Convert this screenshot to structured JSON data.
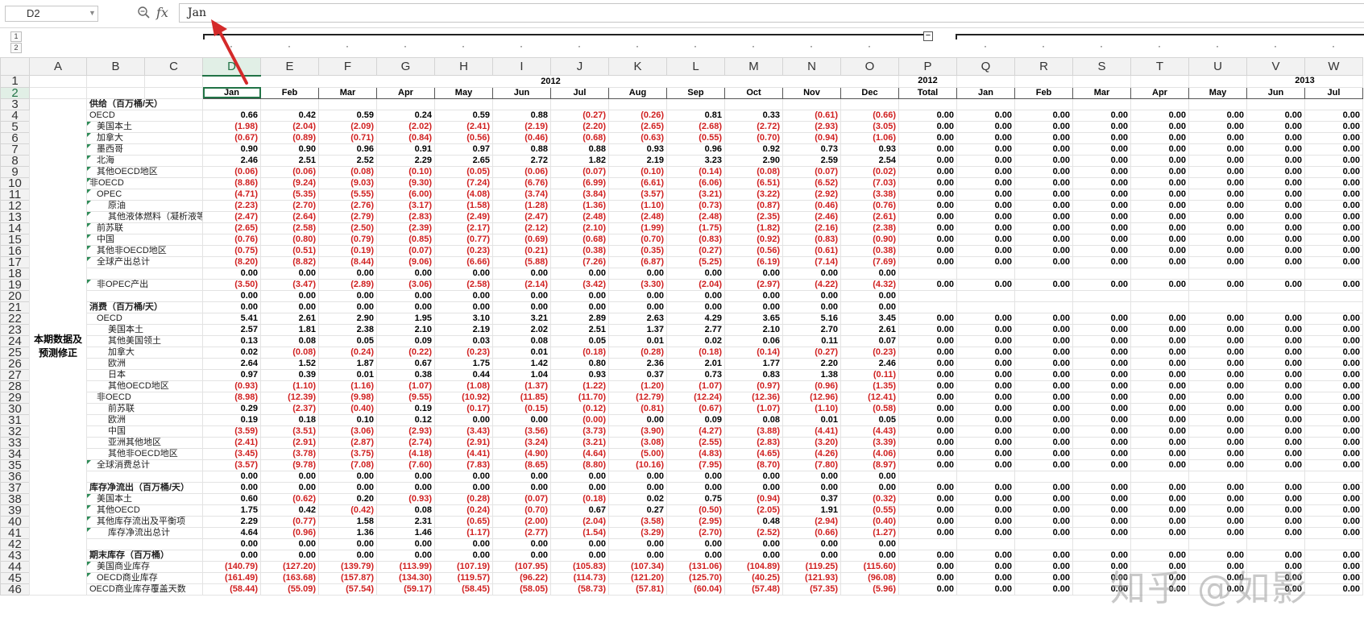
{
  "formula_bar": {
    "name_box": "D2",
    "formula": "Jan"
  },
  "outline": {
    "levels": [
      "1",
      "2"
    ],
    "collapse_symbol": "−"
  },
  "columns": [
    "A",
    "B",
    "C",
    "D",
    "E",
    "F",
    "G",
    "H",
    "I",
    "J",
    "K",
    "L",
    "M",
    "N",
    "O",
    "P",
    "Q",
    "R",
    "S",
    "T",
    "U",
    "V",
    "W"
  ],
  "row1": {
    "y2012": "2012",
    "y2012_total": "2012",
    "y2013": "2013"
  },
  "row2": [
    "Jan",
    "Feb",
    "Mar",
    "Apr",
    "May",
    "Jun",
    "Jul",
    "Aug",
    "Sep",
    "Oct",
    "Nov",
    "Dec",
    "Total",
    "Jan",
    "Feb",
    "Mar",
    "Apr",
    "May",
    "Jun",
    "Jul"
  ],
  "merged_label": "本期数据及预测修正",
  "rows": [
    {
      "r": 3,
      "label": "供给（百万桶/天）",
      "indent": 0,
      "bold": true,
      "vals": [],
      "tail": ""
    },
    {
      "r": 4,
      "label": "OECD",
      "indent": 0,
      "vals": [
        "0.66",
        "0.42",
        "0.59",
        "0.24",
        "0.59",
        "0.88",
        "(0.27)",
        "(0.26)",
        "0.81",
        "0.33",
        "(0.61)",
        "(0.66)"
      ],
      "tail": "z"
    },
    {
      "r": 5,
      "label": "美国本土",
      "indent": 1,
      "tri": true,
      "vals": [
        "(1.98)",
        "(2.04)",
        "(2.09)",
        "(2.02)",
        "(2.41)",
        "(2.19)",
        "(2.20)",
        "(2.65)",
        "(2.68)",
        "(2.72)",
        "(2.93)",
        "(3.05)"
      ],
      "tail": "z"
    },
    {
      "r": 6,
      "label": "加拿大",
      "indent": 1,
      "tri": true,
      "vals": [
        "(0.67)",
        "(0.89)",
        "(0.71)",
        "(0.84)",
        "(0.56)",
        "(0.46)",
        "(0.68)",
        "(0.63)",
        "(0.55)",
        "(0.70)",
        "(0.94)",
        "(1.06)"
      ],
      "tail": "z"
    },
    {
      "r": 7,
      "label": "墨西哥",
      "indent": 1,
      "tri": true,
      "vals": [
        "0.90",
        "0.90",
        "0.96",
        "0.91",
        "0.97",
        "0.88",
        "0.88",
        "0.93",
        "0.96",
        "0.92",
        "0.73",
        "0.93"
      ],
      "tail": "z"
    },
    {
      "r": 8,
      "label": "北海",
      "indent": 1,
      "tri": true,
      "vals": [
        "2.46",
        "2.51",
        "2.52",
        "2.29",
        "2.65",
        "2.72",
        "1.82",
        "2.19",
        "3.23",
        "2.90",
        "2.59",
        "2.54"
      ],
      "tail": "z"
    },
    {
      "r": 9,
      "label": "其他OECD地区",
      "indent": 1,
      "tri": true,
      "vals": [
        "(0.06)",
        "(0.06)",
        "(0.08)",
        "(0.10)",
        "(0.05)",
        "(0.06)",
        "(0.07)",
        "(0.10)",
        "(0.14)",
        "(0.08)",
        "(0.07)",
        "(0.02)"
      ],
      "tail": "z"
    },
    {
      "r": 10,
      "label": "非OECD",
      "indent": 0,
      "tri": true,
      "vals": [
        "(8.86)",
        "(9.24)",
        "(9.03)",
        "(9.30)",
        "(7.24)",
        "(6.76)",
        "(6.99)",
        "(6.61)",
        "(6.06)",
        "(6.51)",
        "(6.52)",
        "(7.03)"
      ],
      "tail": "z"
    },
    {
      "r": 11,
      "label": "OPEC",
      "indent": 1,
      "tri": true,
      "vals": [
        "(4.71)",
        "(5.35)",
        "(5.55)",
        "(6.00)",
        "(4.08)",
        "(3.74)",
        "(3.84)",
        "(3.57)",
        "(3.21)",
        "(3.22)",
        "(2.92)",
        "(3.38)"
      ],
      "tail": "z"
    },
    {
      "r": 12,
      "label": "原油",
      "indent": 2,
      "tri": true,
      "vals": [
        "(2.23)",
        "(2.70)",
        "(2.76)",
        "(3.17)",
        "(1.58)",
        "(1.28)",
        "(1.36)",
        "(1.10)",
        "(0.73)",
        "(0.87)",
        "(0.46)",
        "(0.76)"
      ],
      "tail": "z"
    },
    {
      "r": 13,
      "label": "其他液体燃料（凝析液等）",
      "indent": 2,
      "tri": true,
      "vals": [
        "(2.47)",
        "(2.64)",
        "(2.79)",
        "(2.83)",
        "(2.49)",
        "(2.47)",
        "(2.48)",
        "(2.48)",
        "(2.48)",
        "(2.35)",
        "(2.46)",
        "(2.61)"
      ],
      "tail": "z"
    },
    {
      "r": 14,
      "label": "前苏联",
      "indent": 1,
      "tri": true,
      "vals": [
        "(2.65)",
        "(2.58)",
        "(2.50)",
        "(2.39)",
        "(2.17)",
        "(2.12)",
        "(2.10)",
        "(1.99)",
        "(1.75)",
        "(1.82)",
        "(2.16)",
        "(2.38)"
      ],
      "tail": "z"
    },
    {
      "r": 15,
      "label": "中国",
      "indent": 1,
      "tri": true,
      "vals": [
        "(0.76)",
        "(0.80)",
        "(0.79)",
        "(0.85)",
        "(0.77)",
        "(0.69)",
        "(0.68)",
        "(0.70)",
        "(0.83)",
        "(0.92)",
        "(0.83)",
        "(0.90)"
      ],
      "tail": "z"
    },
    {
      "r": 16,
      "label": "其他非OECD地区",
      "indent": 1,
      "tri": true,
      "vals": [
        "(0.75)",
        "(0.51)",
        "(0.19)",
        "(0.07)",
        "(0.23)",
        "(0.21)",
        "(0.38)",
        "(0.35)",
        "(0.27)",
        "(0.56)",
        "(0.61)",
        "(0.38)"
      ],
      "tail": "z"
    },
    {
      "r": 17,
      "label": "全球产出总计",
      "indent": 1,
      "tri": true,
      "vals": [
        "(8.20)",
        "(8.82)",
        "(8.44)",
        "(9.06)",
        "(6.66)",
        "(5.88)",
        "(7.26)",
        "(6.87)",
        "(5.25)",
        "(6.19)",
        "(7.14)",
        "(7.69)"
      ],
      "tail": "z"
    },
    {
      "r": 18,
      "label": "",
      "indent": 0,
      "vals": [
        "0.00",
        "0.00",
        "0.00",
        "0.00",
        "0.00",
        "0.00",
        "0.00",
        "0.00",
        "0.00",
        "0.00",
        "0.00",
        "0.00"
      ],
      "tail": ""
    },
    {
      "r": 19,
      "label": "非OPEC产出",
      "indent": 1,
      "tri": true,
      "vals": [
        "(3.50)",
        "(3.47)",
        "(2.89)",
        "(3.06)",
        "(2.58)",
        "(2.14)",
        "(3.42)",
        "(3.30)",
        "(2.04)",
        "(2.97)",
        "(4.22)",
        "(4.32)"
      ],
      "tail": "z"
    },
    {
      "r": 20,
      "label": "",
      "indent": 0,
      "vals": [
        "0.00",
        "0.00",
        "0.00",
        "0.00",
        "0.00",
        "0.00",
        "0.00",
        "0.00",
        "0.00",
        "0.00",
        "0.00",
        "0.00"
      ],
      "tail": ""
    },
    {
      "r": 21,
      "label": "消费（百万桶/天）",
      "indent": 0,
      "bold": true,
      "vals": [
        "0.00",
        "0.00",
        "0.00",
        "0.00",
        "0.00",
        "0.00",
        "0.00",
        "0.00",
        "0.00",
        "0.00",
        "0.00",
        "0.00"
      ],
      "tail": ""
    },
    {
      "r": 22,
      "label": "OECD",
      "indent": 1,
      "vals": [
        "5.41",
        "2.61",
        "2.90",
        "1.95",
        "3.10",
        "3.21",
        "2.89",
        "2.63",
        "4.29",
        "3.65",
        "5.16",
        "3.45"
      ],
      "tail": "z"
    },
    {
      "r": 23,
      "label": "美国本土",
      "indent": 2,
      "vals": [
        "2.57",
        "1.81",
        "2.38",
        "2.10",
        "2.19",
        "2.02",
        "2.51",
        "1.37",
        "2.77",
        "2.10",
        "2.70",
        "2.61"
      ],
      "tail": "z"
    },
    {
      "r": 24,
      "label": "其他美国领土",
      "indent": 2,
      "vals": [
        "0.13",
        "0.08",
        "0.05",
        "0.09",
        "0.03",
        "0.08",
        "0.05",
        "0.01",
        "0.02",
        "0.06",
        "0.11",
        "0.07"
      ],
      "tail": "z"
    },
    {
      "r": 25,
      "label": "加拿大",
      "indent": 2,
      "vals": [
        "0.02",
        "(0.08)",
        "(0.24)",
        "(0.22)",
        "(0.23)",
        "0.01",
        "(0.18)",
        "(0.28)",
        "(0.18)",
        "(0.14)",
        "(0.27)",
        "(0.23)"
      ],
      "tail": "z"
    },
    {
      "r": 26,
      "label": "欧洲",
      "indent": 2,
      "vals": [
        "2.64",
        "1.52",
        "1.87",
        "0.67",
        "1.75",
        "1.42",
        "0.80",
        "2.36",
        "2.01",
        "1.77",
        "2.20",
        "2.46"
      ],
      "tail": "z"
    },
    {
      "r": 27,
      "label": "日本",
      "indent": 2,
      "vals": [
        "0.97",
        "0.39",
        "0.01",
        "0.38",
        "0.44",
        "1.04",
        "0.93",
        "0.37",
        "0.73",
        "0.83",
        "1.38",
        "(0.11)"
      ],
      "tail": "z"
    },
    {
      "r": 28,
      "label": "其他OECD地区",
      "indent": 2,
      "vals": [
        "(0.93)",
        "(1.10)",
        "(1.16)",
        "(1.07)",
        "(1.08)",
        "(1.37)",
        "(1.22)",
        "(1.20)",
        "(1.07)",
        "(0.97)",
        "(0.96)",
        "(1.35)"
      ],
      "tail": "z"
    },
    {
      "r": 29,
      "label": "非OECD",
      "indent": 1,
      "vals": [
        "(8.98)",
        "(12.39)",
        "(9.98)",
        "(9.55)",
        "(10.92)",
        "(11.85)",
        "(11.70)",
        "(12.79)",
        "(12.24)",
        "(12.36)",
        "(12.96)",
        "(12.41)"
      ],
      "tail": "z"
    },
    {
      "r": 30,
      "label": "前苏联",
      "indent": 2,
      "vals": [
        "0.29",
        "(2.37)",
        "(0.40)",
        "0.19",
        "(0.17)",
        "(0.15)",
        "(0.12)",
        "(0.81)",
        "(0.67)",
        "(1.07)",
        "(1.10)",
        "(0.58)"
      ],
      "tail": "z"
    },
    {
      "r": 31,
      "label": "欧洲",
      "indent": 2,
      "vals": [
        "0.19",
        "0.18",
        "0.10",
        "0.12",
        "0.00",
        "0.00",
        "(0.00)",
        "0.00",
        "0.09",
        "0.08",
        "0.01",
        "0.05"
      ],
      "tail": "z"
    },
    {
      "r": 32,
      "label": "中国",
      "indent": 2,
      "vals": [
        "(3.59)",
        "(3.51)",
        "(3.06)",
        "(2.93)",
        "(3.43)",
        "(3.56)",
        "(3.73)",
        "(3.90)",
        "(4.27)",
        "(3.88)",
        "(4.41)",
        "(4.43)"
      ],
      "tail": "z"
    },
    {
      "r": 33,
      "label": "亚洲其他地区",
      "indent": 2,
      "vals": [
        "(2.41)",
        "(2.91)",
        "(2.87)",
        "(2.74)",
        "(2.91)",
        "(3.24)",
        "(3.21)",
        "(3.08)",
        "(2.55)",
        "(2.83)",
        "(3.20)",
        "(3.39)"
      ],
      "tail": "z"
    },
    {
      "r": 34,
      "label": "其他非OECD地区",
      "indent": 2,
      "vals": [
        "(3.45)",
        "(3.78)",
        "(3.75)",
        "(4.18)",
        "(4.41)",
        "(4.90)",
        "(4.64)",
        "(5.00)",
        "(4.83)",
        "(4.65)",
        "(4.26)",
        "(4.06)"
      ],
      "tail": "z"
    },
    {
      "r": 35,
      "label": "全球消费总计",
      "indent": 1,
      "tri": true,
      "vals": [
        "(3.57)",
        "(9.78)",
        "(7.08)",
        "(7.60)",
        "(7.83)",
        "(8.65)",
        "(8.80)",
        "(10.16)",
        "(7.95)",
        "(8.70)",
        "(7.80)",
        "(8.97)"
      ],
      "tail": "z"
    },
    {
      "r": 36,
      "label": "",
      "indent": 0,
      "vals": [
        "0.00",
        "0.00",
        "0.00",
        "0.00",
        "0.00",
        "0.00",
        "0.00",
        "0.00",
        "0.00",
        "0.00",
        "0.00",
        "0.00"
      ],
      "tail": ""
    },
    {
      "r": 37,
      "label": "库存净流出（百万桶/天）",
      "indent": 0,
      "bold": true,
      "vals": [
        "0.00",
        "0.00",
        "0.00",
        "0.00",
        "0.00",
        "0.00",
        "0.00",
        "0.00",
        "0.00",
        "0.00",
        "0.00",
        "0.00"
      ],
      "tail": "z"
    },
    {
      "r": 38,
      "label": "美国本土",
      "indent": 1,
      "tri": true,
      "vals": [
        "0.60",
        "(0.62)",
        "0.20",
        "(0.93)",
        "(0.28)",
        "(0.07)",
        "(0.18)",
        "0.02",
        "0.75",
        "(0.94)",
        "0.37",
        "(0.32)"
      ],
      "tail": "z"
    },
    {
      "r": 39,
      "label": "其他OECD",
      "indent": 1,
      "tri": true,
      "vals": [
        "1.75",
        "0.42",
        "(0.42)",
        "0.08",
        "(0.24)",
        "(0.70)",
        "0.67",
        "0.27",
        "(0.50)",
        "(2.05)",
        "1.91",
        "(0.55)"
      ],
      "tail": "z"
    },
    {
      "r": 40,
      "label": "其他库存流出及平衡项",
      "indent": 1,
      "tri": true,
      "vals": [
        "2.29",
        "(0.77)",
        "1.58",
        "2.31",
        "(0.65)",
        "(2.00)",
        "(2.04)",
        "(3.58)",
        "(2.95)",
        "0.48",
        "(2.94)",
        "(0.40)"
      ],
      "tail": "z"
    },
    {
      "r": 41,
      "label": "库存净流出总计",
      "indent": 2,
      "tri": true,
      "vals": [
        "4.64",
        "(0.96)",
        "1.36",
        "1.46",
        "(1.17)",
        "(2.77)",
        "(1.54)",
        "(3.29)",
        "(2.70)",
        "(2.52)",
        "(0.66)",
        "(1.27)"
      ],
      "tail": "z"
    },
    {
      "r": 42,
      "label": "",
      "indent": 0,
      "vals": [
        "0.00",
        "0.00",
        "0.00",
        "0.00",
        "0.00",
        "0.00",
        "0.00",
        "0.00",
        "0.00",
        "0.00",
        "0.00",
        "0.00"
      ],
      "tail": ""
    },
    {
      "r": 43,
      "label": "期末库存（百万桶）",
      "indent": 0,
      "bold": true,
      "vals": [
        "0.00",
        "0.00",
        "0.00",
        "0.00",
        "0.00",
        "0.00",
        "0.00",
        "0.00",
        "0.00",
        "0.00",
        "0.00",
        "0.00"
      ],
      "tail": "z"
    },
    {
      "r": 44,
      "label": "美国商业库存",
      "indent": 1,
      "tri": true,
      "vals": [
        "(140.79)",
        "(127.20)",
        "(139.79)",
        "(113.99)",
        "(107.19)",
        "(107.95)",
        "(105.83)",
        "(107.34)",
        "(131.06)",
        "(104.89)",
        "(119.25)",
        "(115.60)"
      ],
      "tail": "z"
    },
    {
      "r": 45,
      "label": "OECD商业库存",
      "indent": 1,
      "tri": true,
      "vals": [
        "(161.49)",
        "(163.68)",
        "(157.87)",
        "(134.30)",
        "(119.57)",
        "(96.22)",
        "(114.73)",
        "(121.20)",
        "(125.70)",
        "(40.25)",
        "(121.93)",
        "(96.08)"
      ],
      "tail": "z"
    },
    {
      "r": 46,
      "label": "OECD商业库存覆盖天数",
      "indent": 0,
      "vals": [
        "(58.44)",
        "(55.09)",
        "(57.54)",
        "(59.17)",
        "(58.45)",
        "(58.05)",
        "(58.73)",
        "(57.81)",
        "(60.04)",
        "(57.48)",
        "(57.35)",
        "(5.96)"
      ],
      "tail": "z"
    }
  ],
  "tail_zero": "0.00",
  "watermark": "知乎 @如影",
  "colors": {
    "negative": "#d02020",
    "selection": "#217346",
    "arrow": "#d42a2a"
  }
}
